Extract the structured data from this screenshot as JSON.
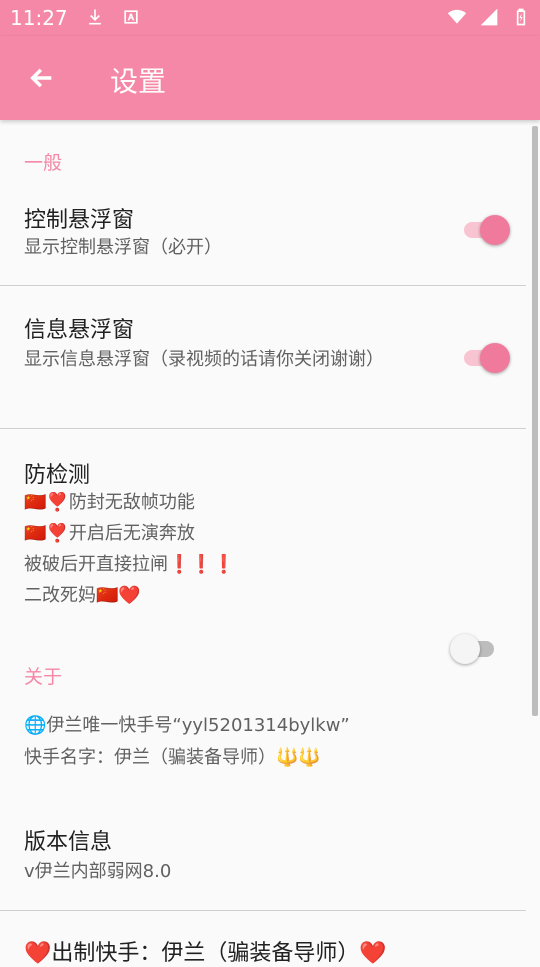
{
  "status": {
    "time": "11:27"
  },
  "app_bar": {
    "title": "设置"
  },
  "sections": {
    "general": "一般",
    "about": "关于"
  },
  "prefs": {
    "control_float": {
      "title": "控制悬浮窗",
      "summary": "显示控制悬浮窗（必开）",
      "enabled": true
    },
    "info_float": {
      "title": "信息悬浮窗",
      "summary": "显示信息悬浮窗（录视频的话请你关闭谢谢）",
      "enabled": true
    },
    "anti_detect": {
      "title": "防检测",
      "lines": [
        "🇨🇳❣️防封无敌帧功能",
        "🇨🇳❣️开启后无演奔放",
        "被破后开直接拉闸❗❗❗",
        "二改死妈🇨🇳❤️"
      ],
      "enabled": false
    },
    "kuaishou": {
      "line1": "🌐伊兰唯一快手号“yyl5201314bylkw”",
      "line2": "快手名字：伊兰（骗装备导师）🔱🔱"
    },
    "version": {
      "title": "版本信息",
      "summary": "v伊兰内部弱网8.0"
    },
    "producer": {
      "title": "❤️出制快手：伊兰（骗装备导师）❤️"
    }
  },
  "colors": {
    "accent": "#f488a6",
    "toggle_on": "#f07a9b"
  }
}
